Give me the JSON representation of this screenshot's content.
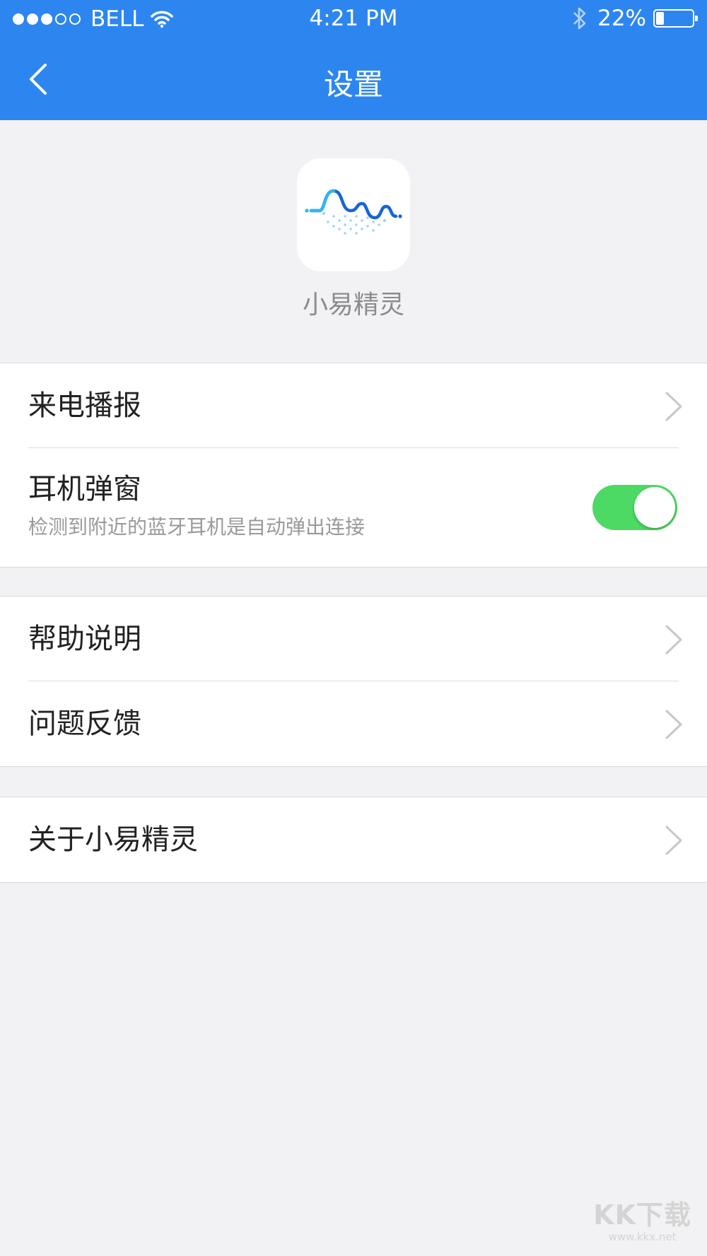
{
  "status_bar": {
    "carrier": "BELL",
    "time": "4:21 PM",
    "battery_percent": "22%",
    "battery_level": 0.22,
    "signal_bars_filled": 3,
    "signal_bars_total": 5,
    "icons": [
      "wifi-icon",
      "bluetooth-icon",
      "battery-icon"
    ]
  },
  "nav": {
    "title": "设置",
    "back_icon": "chevron-left-icon"
  },
  "app": {
    "name": "小易精灵",
    "icon": "waveform-logo-icon"
  },
  "settings": {
    "group1": {
      "items": [
        {
          "label": "来电播报",
          "icon": "chevron-right-icon"
        },
        {
          "label": "耳机弹窗",
          "subtitle": "检测到附近的蓝牙耳机是自动弹出连接",
          "toggle_on": true
        }
      ]
    },
    "group2": {
      "items": [
        {
          "label": "帮助说明",
          "icon": "chevron-right-icon"
        },
        {
          "label": "问题反馈",
          "icon": "chevron-right-icon"
        }
      ]
    },
    "group3": {
      "items": [
        {
          "label": "关于小易精灵",
          "icon": "chevron-right-icon"
        }
      ]
    }
  },
  "watermark": {
    "logo_text": "KK下载",
    "url": "www.kkx.net"
  },
  "colors": {
    "accent": "#2d86f0",
    "toggle_on": "#4cd964",
    "background": "#f2f2f4"
  }
}
